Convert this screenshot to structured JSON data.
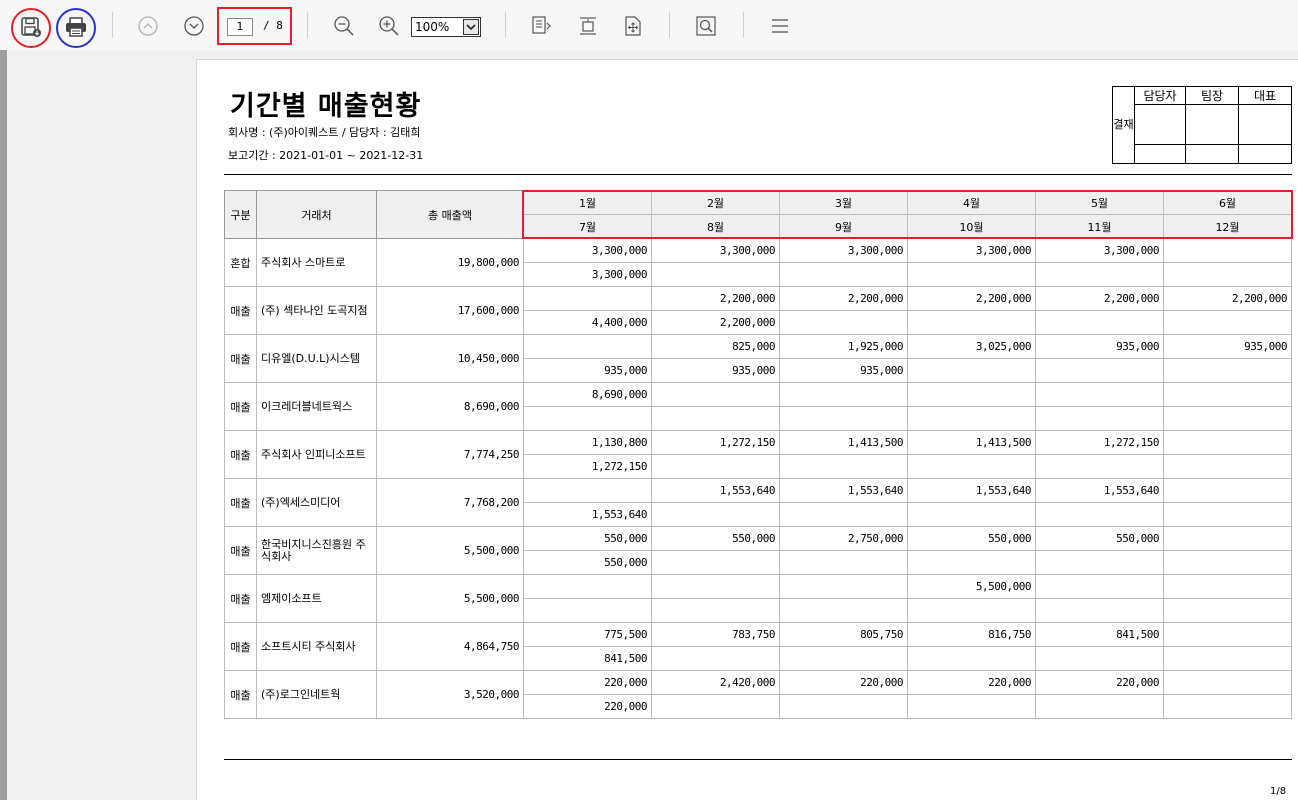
{
  "toolbar": {
    "page_current": "1",
    "page_sep": "/",
    "page_total": "8",
    "zoom": "100%",
    "highlight_colors": {
      "save": "#e0202a",
      "print": "#2a35c8",
      "pager": "#e0202a"
    }
  },
  "report": {
    "title": "기간별 매출현황",
    "company_line": "회사명 : (주)아이퀘스트 / 담당자 : 김태희",
    "period_line": "보고기간 : 2021-01-01 ~ 2021-12-31",
    "approval": {
      "side_label": "결재",
      "roles": [
        "담당자",
        "팀장",
        "대표"
      ]
    },
    "headers": {
      "gubun": "구분",
      "customer": "거래처",
      "total": "총 매출액",
      "months_top": [
        "1월",
        "2월",
        "3월",
        "4월",
        "5월",
        "6월"
      ],
      "months_bottom": [
        "7월",
        "8월",
        "9월",
        "10월",
        "11월",
        "12월"
      ]
    },
    "rows": [
      {
        "type": "혼합",
        "customer": "주식회사 스마트로",
        "total": "19,800,000",
        "top": [
          "3,300,000",
          "3,300,000",
          "3,300,000",
          "3,300,000",
          "3,300,000",
          ""
        ],
        "bottom": [
          "3,300,000",
          "",
          "",
          "",
          "",
          ""
        ]
      },
      {
        "type": "매출",
        "customer": "(주) 섹타나인 도곡지점",
        "total": "17,600,000",
        "top": [
          "",
          "2,200,000",
          "2,200,000",
          "2,200,000",
          "2,200,000",
          "2,200,000"
        ],
        "bottom": [
          "4,400,000",
          "2,200,000",
          "",
          "",
          "",
          ""
        ]
      },
      {
        "type": "매출",
        "customer": "디유엘(D.U.L)시스템",
        "total": "10,450,000",
        "top": [
          "",
          "825,000",
          "1,925,000",
          "3,025,000",
          "935,000",
          "935,000"
        ],
        "bottom": [
          "935,000",
          "935,000",
          "935,000",
          "",
          "",
          ""
        ]
      },
      {
        "type": "매출",
        "customer": "이크레더블네트웍스",
        "total": "8,690,000",
        "top": [
          "8,690,000",
          "",
          "",
          "",
          "",
          ""
        ],
        "bottom": [
          "",
          "",
          "",
          "",
          "",
          ""
        ]
      },
      {
        "type": "매출",
        "customer": "주식회사 인피니소프트",
        "total": "7,774,250",
        "top": [
          "1,130,800",
          "1,272,150",
          "1,413,500",
          "1,413,500",
          "1,272,150",
          ""
        ],
        "bottom": [
          "1,272,150",
          "",
          "",
          "",
          "",
          ""
        ]
      },
      {
        "type": "매출",
        "customer": "(주)엑세스미디어",
        "total": "7,768,200",
        "top": [
          "",
          "1,553,640",
          "1,553,640",
          "1,553,640",
          "1,553,640",
          ""
        ],
        "bottom": [
          "1,553,640",
          "",
          "",
          "",
          "",
          ""
        ]
      },
      {
        "type": "매출",
        "customer": "한국비지니스진흥원 주식회사",
        "total": "5,500,000",
        "top": [
          "550,000",
          "550,000",
          "2,750,000",
          "550,000",
          "550,000",
          ""
        ],
        "bottom": [
          "550,000",
          "",
          "",
          "",
          "",
          ""
        ]
      },
      {
        "type": "매출",
        "customer": "엠제이소프트",
        "total": "5,500,000",
        "top": [
          "",
          "",
          "",
          "5,500,000",
          "",
          ""
        ],
        "bottom": [
          "",
          "",
          "",
          "",
          "",
          ""
        ]
      },
      {
        "type": "매출",
        "customer": "소프트시티 주식회사",
        "total": "4,864,750",
        "top": [
          "775,500",
          "783,750",
          "805,750",
          "816,750",
          "841,500",
          ""
        ],
        "bottom": [
          "841,500",
          "",
          "",
          "",
          "",
          ""
        ]
      },
      {
        "type": "매출",
        "customer": "(주)로그인네트웍",
        "total": "3,520,000",
        "top": [
          "220,000",
          "2,420,000",
          "220,000",
          "220,000",
          "220,000",
          ""
        ],
        "bottom": [
          "220,000",
          "",
          "",
          "",
          "",
          ""
        ]
      }
    ],
    "footer_page": "1/8"
  }
}
